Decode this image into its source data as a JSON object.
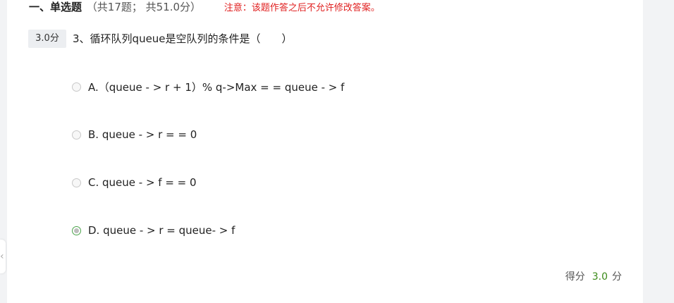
{
  "section": {
    "title": "一、单选题",
    "meta": "（共17题； 共51.0分）",
    "notice": "注意：该题作答之后不允许修改答案。"
  },
  "question": {
    "score_tag": "3.0分",
    "text": "3、循环队列queue是空队列的条件是（　　）",
    "options": [
      {
        "label": "A.（queue - > r + 1）% q->Max = = queue - > f",
        "selected": false
      },
      {
        "label": "B. queue - > r = = 0",
        "selected": false
      },
      {
        "label": "C. queue - > f = = 0",
        "selected": false
      },
      {
        "label": "D. queue - > r = queue- > f",
        "selected": true
      }
    ]
  },
  "result": {
    "label": "得分",
    "value": "3.0",
    "unit": "分"
  },
  "colors": {
    "notice": "#e02020",
    "score_value": "#3a8a18",
    "selected_radio_border": "#4aa34a"
  },
  "icons": {
    "left_nav": "chevron-left-icon"
  }
}
